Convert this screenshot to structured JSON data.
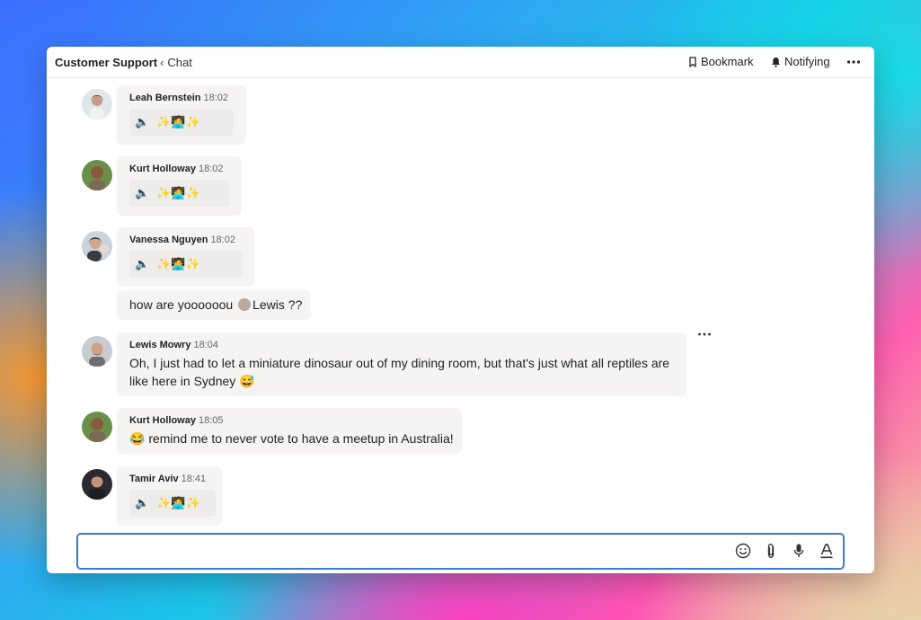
{
  "header": {
    "title": "Customer Support",
    "crumb": "Chat",
    "bookmark_label": "Bookmark",
    "notify_label": "Notifying"
  },
  "messages": [
    {
      "name": "Leah Bernstein",
      "time": "18:02",
      "content": "✨🧑‍💻✨"
    },
    {
      "name": "Kurt Holloway",
      "time": "18:02",
      "content": "✨🧑‍💻✨"
    },
    {
      "name": "Vanessa Nguyen",
      "time": "18:02",
      "content": "✨🧑‍💻✨"
    },
    {
      "text_before": "how are yoooooou",
      "mention": "Lewis",
      "text_after": "??"
    },
    {
      "name": "Lewis Mowry",
      "time": "18:04",
      "line1": "Oh, I just had to let a miniature dinosaur out of my dining room, but that's just what all reptiles are",
      "line2": "like here in Sydney 😅"
    },
    {
      "name": "Kurt Holloway",
      "time": "18:05",
      "text": "😂 remind me to never vote to have a meetup in Australia!"
    },
    {
      "name": "Tamir Aviv",
      "time": "18:41",
      "content": "✨🧑‍💻✨"
    }
  ],
  "composer": {
    "placeholder": "",
    "icons": [
      "smiley-icon",
      "paperclip-icon",
      "microphone-icon",
      "text-format-icon"
    ]
  },
  "colors": {
    "accent": "#3a7bd5",
    "bubble": "#f5f4f3"
  }
}
